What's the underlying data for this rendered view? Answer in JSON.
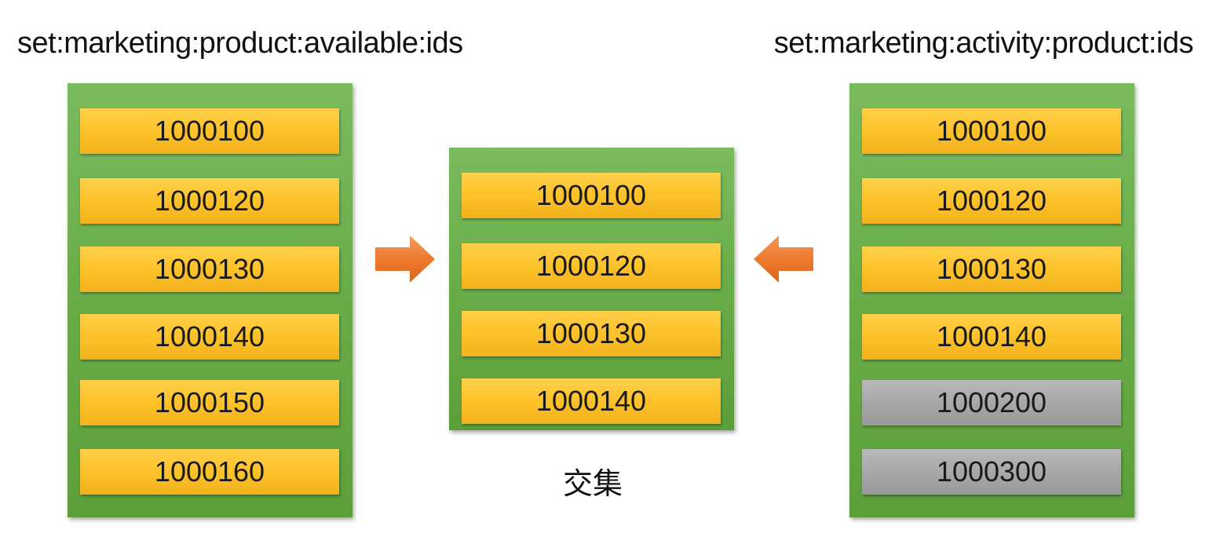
{
  "left_set": {
    "title": "set:marketing:product:available:ids",
    "items": [
      {
        "label": "1000100",
        "color": "yellow"
      },
      {
        "label": "1000120",
        "color": "yellow"
      },
      {
        "label": "1000130",
        "color": "yellow"
      },
      {
        "label": "1000140",
        "color": "yellow"
      },
      {
        "label": "1000150",
        "color": "yellow"
      },
      {
        "label": "1000160",
        "color": "yellow"
      }
    ]
  },
  "intersection_set": {
    "label": "交集",
    "items": [
      {
        "label": "1000100",
        "color": "yellow"
      },
      {
        "label": "1000120",
        "color": "yellow"
      },
      {
        "label": "1000130",
        "color": "yellow"
      },
      {
        "label": "1000140",
        "color": "yellow"
      }
    ]
  },
  "right_set": {
    "title": "set:marketing:activity:product:ids",
    "items": [
      {
        "label": "1000100",
        "color": "yellow"
      },
      {
        "label": "1000120",
        "color": "yellow"
      },
      {
        "label": "1000130",
        "color": "yellow"
      },
      {
        "label": "1000140",
        "color": "yellow"
      },
      {
        "label": "1000200",
        "color": "gray"
      },
      {
        "label": "1000300",
        "color": "gray"
      }
    ]
  },
  "colors": {
    "set_box": "#6aae4a",
    "item_yellow": "#fdc22a",
    "item_gray": "#a8a8a8",
    "arrow": "#ee7a2e"
  },
  "icons": {
    "left_arrow": "arrow-right-icon",
    "right_arrow": "arrow-left-icon"
  }
}
